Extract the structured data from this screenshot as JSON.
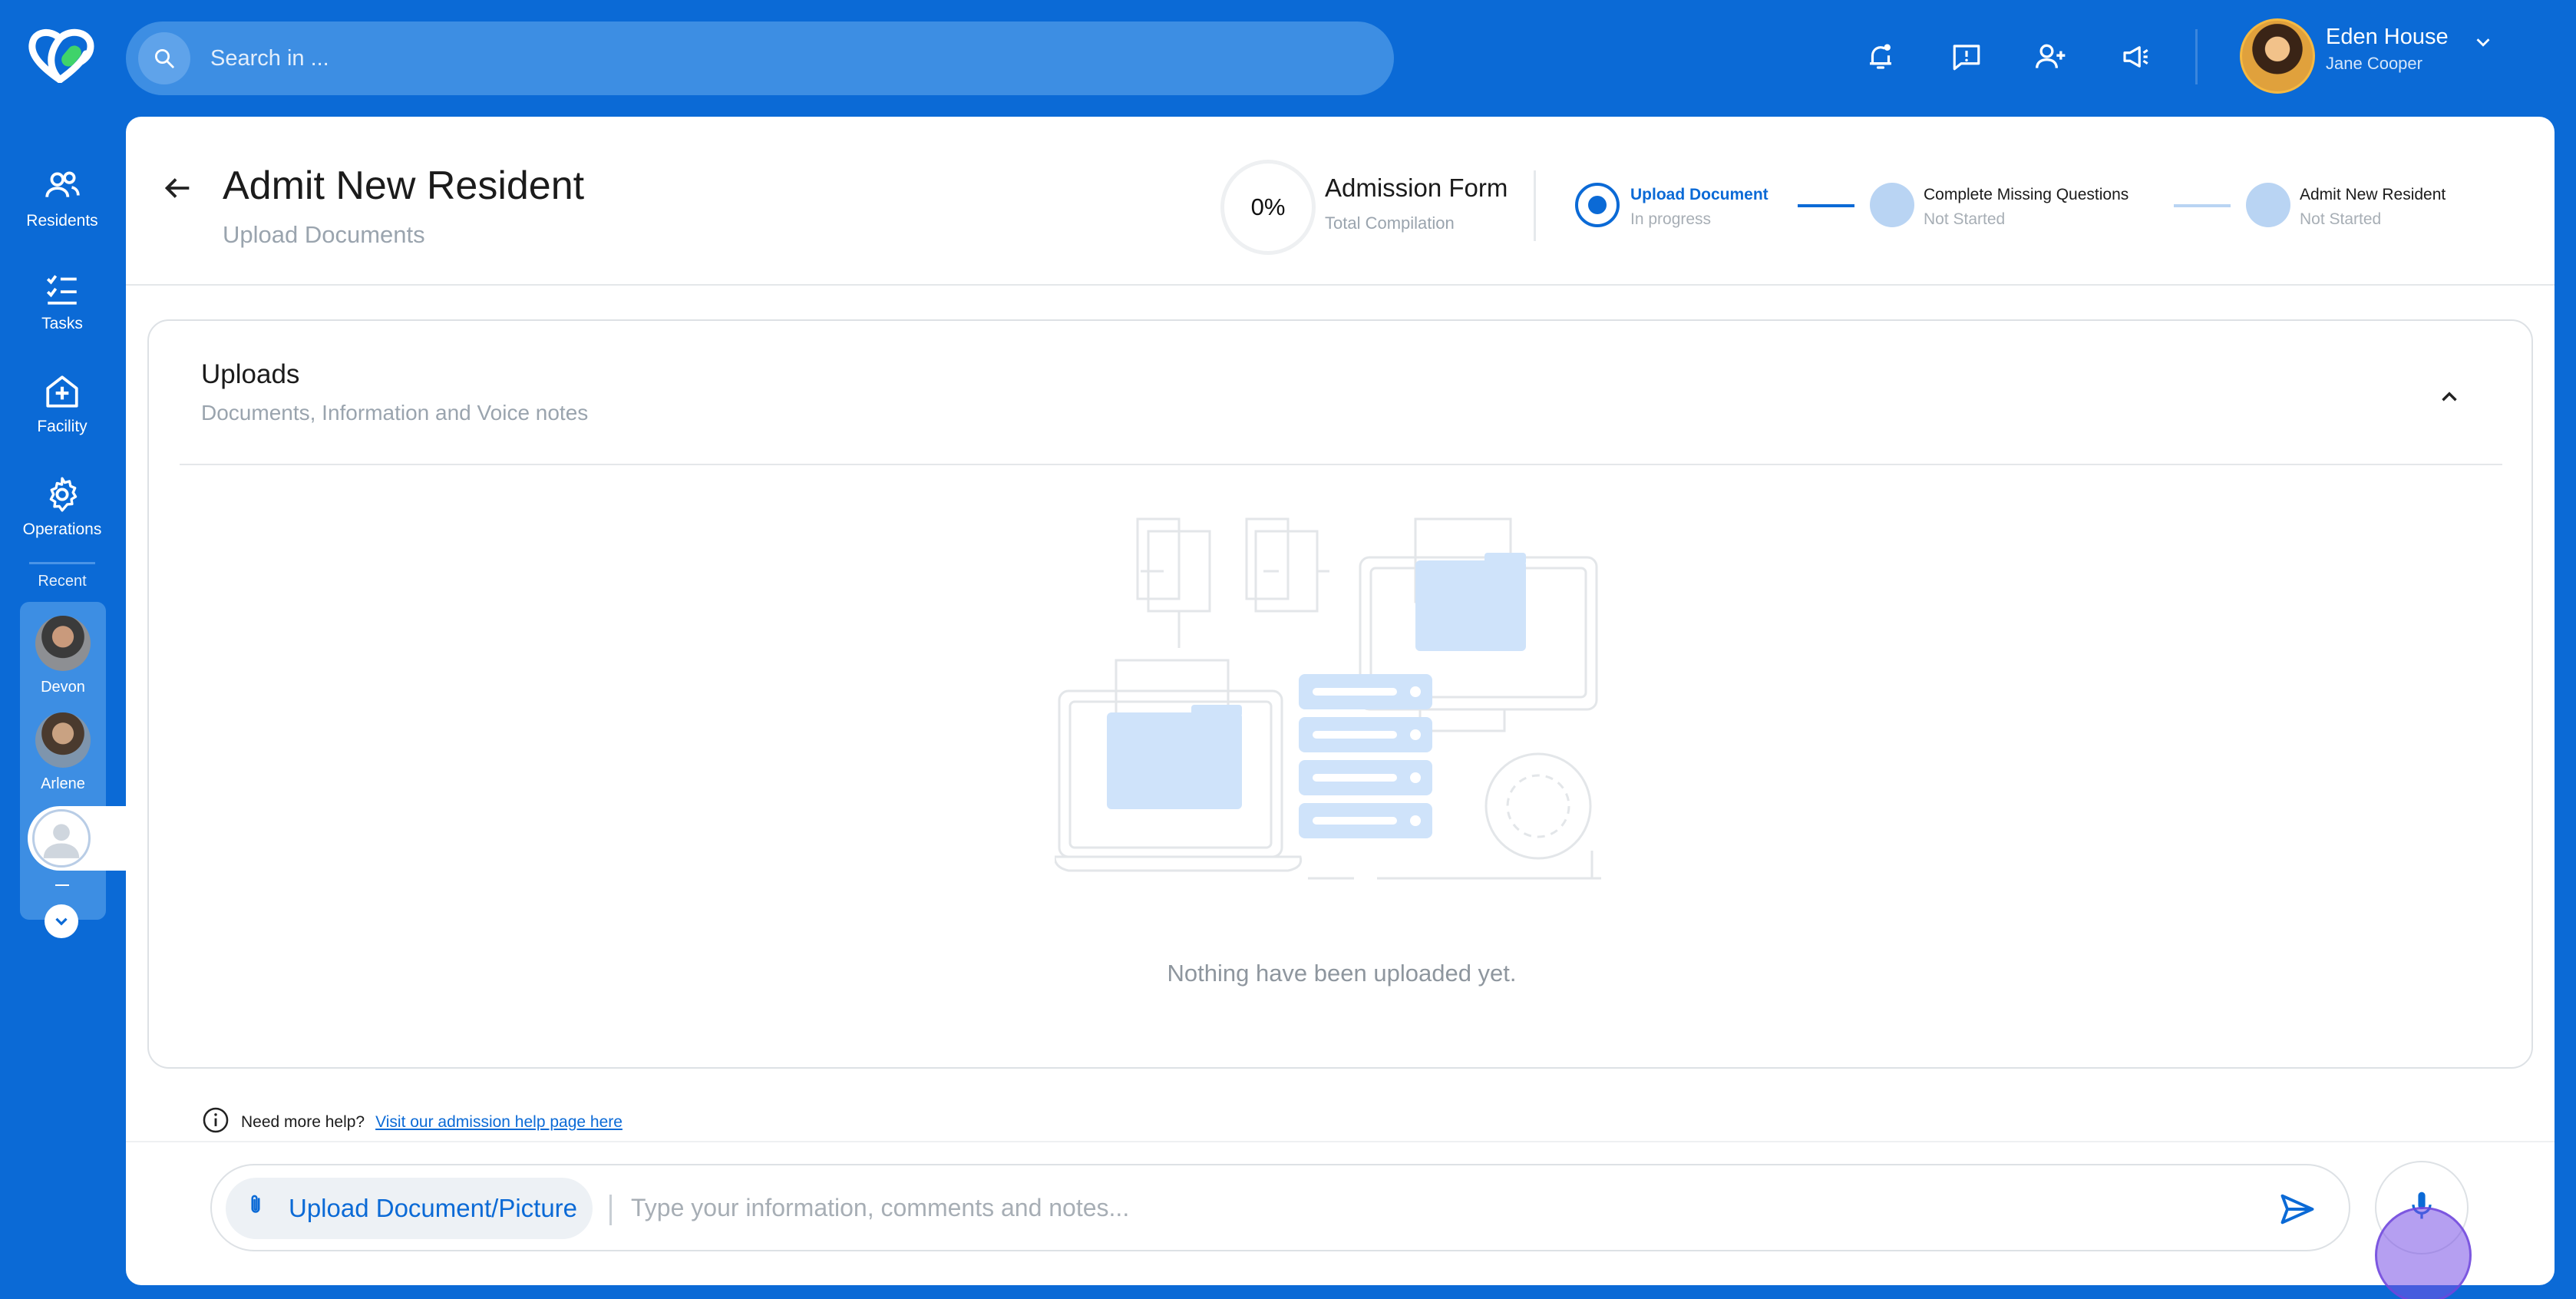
{
  "header": {
    "search_placeholder": "Search in ...",
    "user": {
      "name": "Eden House",
      "subtitle": "Jane Cooper"
    }
  },
  "sidebar": {
    "items": [
      {
        "label": "Residents",
        "icon": "users-icon"
      },
      {
        "label": "Tasks",
        "icon": "checklist-icon"
      },
      {
        "label": "Facility",
        "icon": "facility-plus-icon"
      },
      {
        "label": "Operations",
        "icon": "gear-icon"
      }
    ],
    "recent_label": "Recent",
    "recent": [
      {
        "name": "Devon"
      },
      {
        "name": "Arlene"
      },
      {
        "name": "—"
      }
    ]
  },
  "page": {
    "title": "Admit New Resident",
    "subtitle": "Upload Documents",
    "progress": {
      "value": "0%",
      "title": "Admission Form",
      "subtitle": "Total Compilation"
    },
    "steps": [
      {
        "title": "Upload Document",
        "status": "In progress",
        "state": "active"
      },
      {
        "title": "Complete Missing Questions",
        "status": "Not Started",
        "state": "pending"
      },
      {
        "title": "Admit New Resident",
        "status": "Not Started",
        "state": "pending"
      }
    ]
  },
  "uploads": {
    "title": "Uploads",
    "subtitle": "Documents, Information and Voice notes",
    "empty_message": "Nothing have been uploaded yet."
  },
  "help": {
    "text": "Need more help?",
    "link_text": "Visit our admission help page here"
  },
  "composer": {
    "upload_label": "Upload Document/Picture",
    "placeholder": "Type your information, comments and notes..."
  },
  "colors": {
    "brand": "#0b6ad6",
    "accent_light": "#3d8ee3",
    "pending": "#b9d4f3",
    "illustration_fill": "#cfe3fa"
  }
}
